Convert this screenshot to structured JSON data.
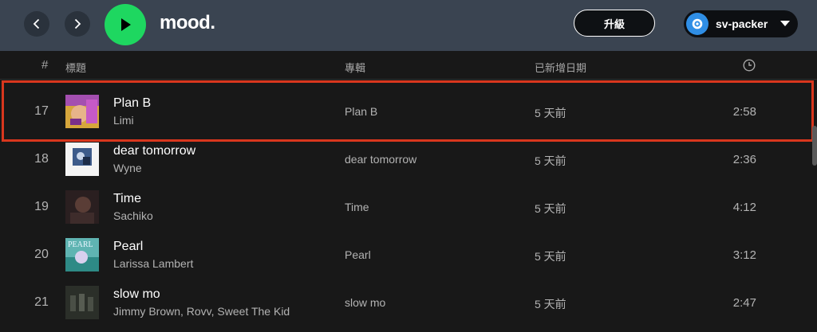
{
  "topbar": {
    "back_icon": "chevron-left-icon",
    "forward_icon": "chevron-right-icon",
    "play_icon": "play-icon",
    "playlist_title": "mood.",
    "upgrade_label": "升級",
    "username": "sv-packer",
    "accent": "#1ed760"
  },
  "columns": {
    "number": "#",
    "title": "標題",
    "album": "專輯",
    "date_added": "已新增日期",
    "duration_icon": "clock-icon"
  },
  "tracks": [
    {
      "number": "17",
      "title": "Plan B",
      "artist": "Limi",
      "album": "Plan B",
      "added": "5 天前",
      "duration": "2:58",
      "highlighted": true
    },
    {
      "number": "18",
      "title": "dear tomorrow",
      "artist": "Wyne",
      "album": "dear tomorrow",
      "added": "5 天前",
      "duration": "2:36"
    },
    {
      "number": "19",
      "title": "Time",
      "artist": "Sachiko",
      "album": "Time",
      "added": "5 天前",
      "duration": "4:12"
    },
    {
      "number": "20",
      "title": "Pearl",
      "artist": "Larissa Lambert",
      "album": "Pearl",
      "added": "5 天前",
      "duration": "3:12",
      "cover_text": "PEARL"
    },
    {
      "number": "21",
      "title": "slow mo",
      "artist": "Jimmy Brown, Rovv, Sweet The Kid",
      "album": "slow mo",
      "added": "5 天前",
      "duration": "2:47"
    }
  ],
  "highlight_color": "#d9371e"
}
